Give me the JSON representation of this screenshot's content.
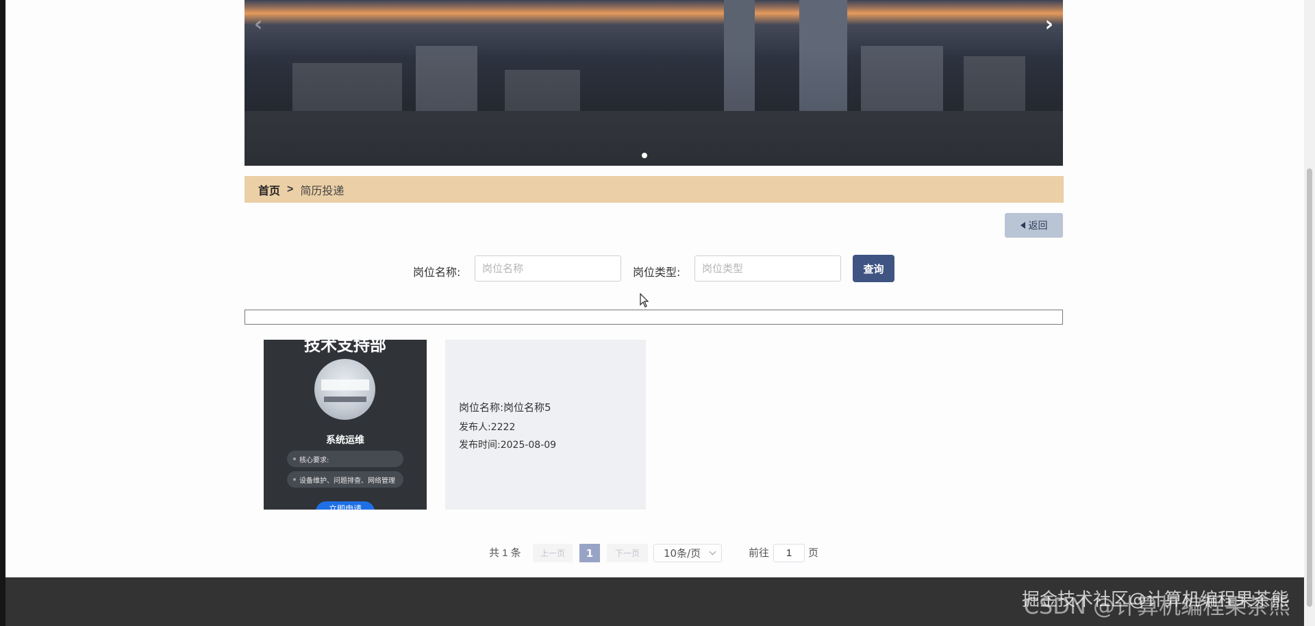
{
  "banner": {
    "prev_icon": "‹",
    "next_icon": "›"
  },
  "breadcrumb": {
    "home": "首页",
    "separator": ">",
    "current": "简历投递"
  },
  "back_button": {
    "label": "返回"
  },
  "search": {
    "job_name_label": "岗位名称:",
    "job_name_placeholder": "岗位名称",
    "job_type_label": "岗位类型:",
    "job_type_placeholder": "岗位类型",
    "query_label": "查询"
  },
  "cards": [
    {
      "department": "技术支持部",
      "title": "系统运维",
      "req_label": "核心要求:",
      "req_text": "设备维护、问题排查、网络管理",
      "apply_label": "立即申请"
    },
    {
      "job_name": "岗位名称:岗位名称5",
      "publisher": "发布人:2222",
      "publish_time": "发布时间:2025-08-09"
    }
  ],
  "pagination": {
    "total": "共 1 条",
    "prev": "上一页",
    "current": "1",
    "next": "下一页",
    "page_size": "10条/页",
    "goto": "前往",
    "goto_value": "1",
    "page_unit": "页"
  },
  "watermark": {
    "csdn": "CSDN @计算机编程果茶熊",
    "juejin": "掘金技术社区@计算机编程果茶熊"
  }
}
